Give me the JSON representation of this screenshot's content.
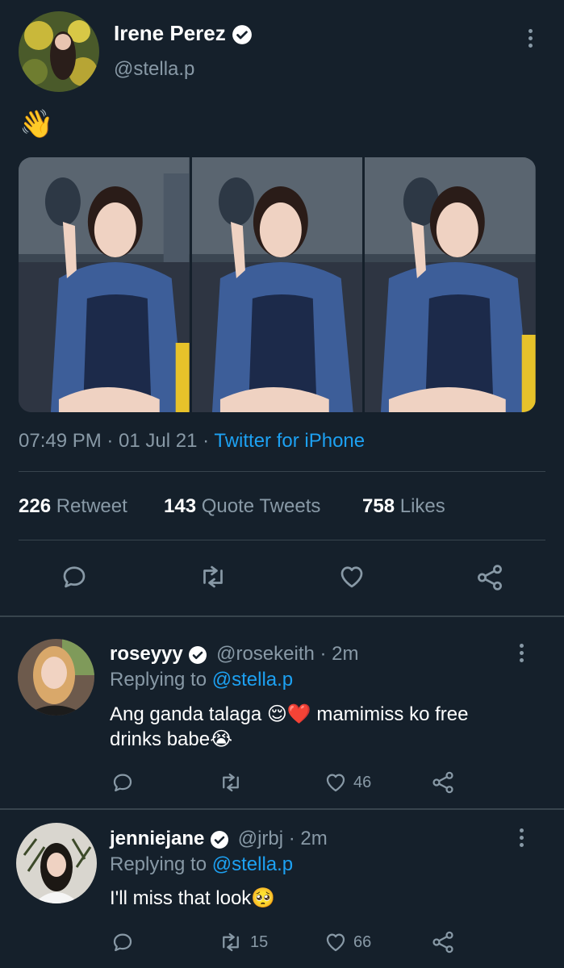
{
  "tweet": {
    "author_name": "Irene Perez",
    "author_handle": "@stella.p",
    "text": "👋",
    "time": "07:49 PM · 01 Jul 21 · ",
    "source": "Twitter for iPhone",
    "stats": {
      "retweets": "226",
      "retweets_label": "Retweet",
      "quotes": "143",
      "quotes_label": "Quote Tweets",
      "likes": "758",
      "likes_label": "Likes"
    }
  },
  "replies": [
    {
      "name": "roseyyy",
      "handle": "@rosekeith",
      "time": "· 2m",
      "replying_label": "Replying to ",
      "replying_to": "@stella.p",
      "text_line1": "Ang ganda talaga 😌❤️ mamimiss ko free",
      "text_line2": "drinks babe😭",
      "retweets": "",
      "likes": "46"
    },
    {
      "name": "jenniejane",
      "handle": "@jrbj",
      "time": "· 2m",
      "replying_label": "Replying to ",
      "replying_to": "@stella.p",
      "text_line1": "I'll miss that look🥺",
      "retweets": "15",
      "likes": "66"
    }
  ],
  "colors": {
    "background": "#15202b",
    "accent": "#1da1f2",
    "muted": "#8899a6",
    "divider": "#38444d"
  }
}
